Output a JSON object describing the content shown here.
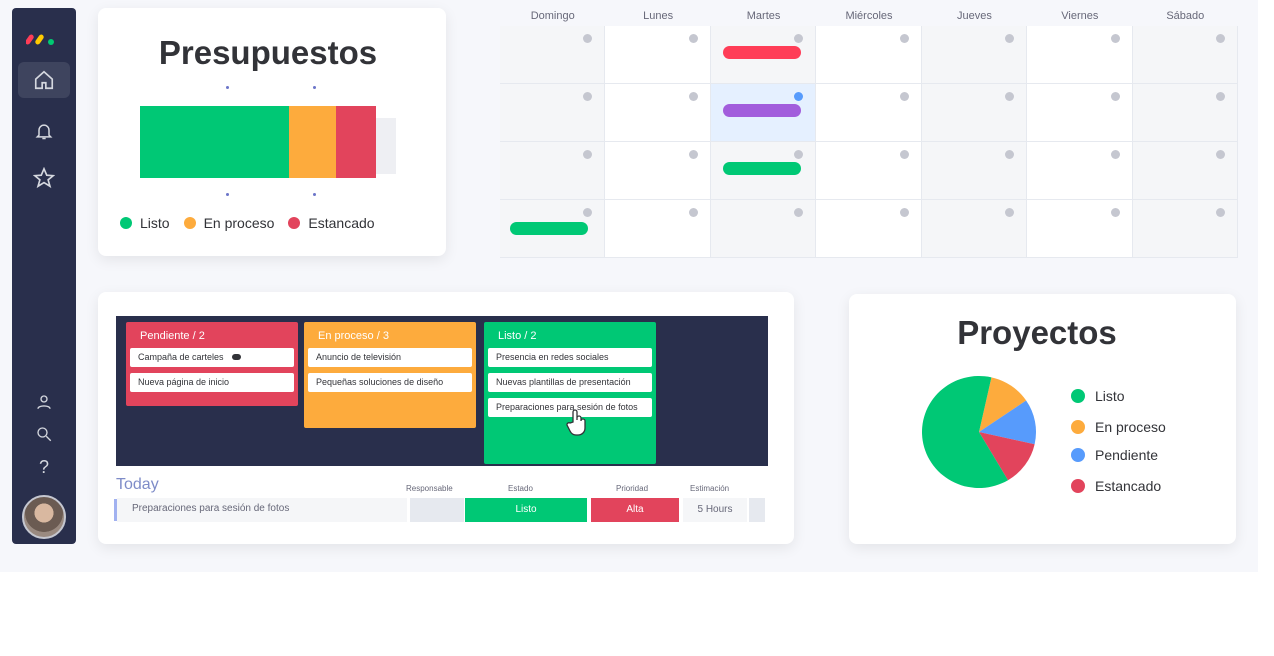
{
  "sidebar": {
    "icons": [
      "home-icon",
      "bell-icon",
      "star-icon",
      "user-icon",
      "search-icon",
      "help-icon"
    ],
    "help_glyph": "?",
    "logo_colors": [
      "#ff3d57",
      "#ffcb00",
      "#00ca72"
    ]
  },
  "budget": {
    "title": "Presupuestos",
    "segments": [
      {
        "label": "Listo",
        "value": 0.63,
        "color": "#00c875"
      },
      {
        "label": "En proceso",
        "value": 0.2,
        "color": "#fdab3d"
      },
      {
        "label": "Estancado",
        "value": 0.17,
        "color": "#e2445c"
      }
    ],
    "legend": [
      "Listo",
      "En proceso",
      "Estancado"
    ]
  },
  "calendar": {
    "days": [
      "Domingo",
      "Lunes",
      "Martes",
      "Miércoles",
      "Jueves",
      "Viernes",
      "Sábado"
    ],
    "events": [
      {
        "week": 0,
        "day": 2,
        "color": "#ff3d57"
      },
      {
        "week": 1,
        "day": 2,
        "color": "#a25ddc"
      },
      {
        "week": 2,
        "day": 2,
        "color": "#00c875"
      },
      {
        "week": 3,
        "day": 0,
        "color": "#00c875"
      }
    ]
  },
  "kanban": {
    "columns": [
      {
        "title": "Pendiente / 2",
        "color": "#e2445c",
        "cards": [
          "Campaña de carteles",
          "Nueva página de inicio"
        ]
      },
      {
        "title": "En proceso / 3",
        "color": "#fdab3d",
        "cards": [
          "Anuncio de televisión",
          "Pequeñas soluciones de diseño"
        ]
      },
      {
        "title": "Listo / 2",
        "color": "#00c875",
        "cards": [
          "Presencia en redes sociales",
          "Nuevas plantillas de presentación",
          "Preparaciones para sesión de fotos"
        ]
      }
    ],
    "today": {
      "label": "Today",
      "headers": [
        "Responsable",
        "Estado",
        "Prioridad",
        "Estimación"
      ],
      "row": {
        "name": "Preparaciones para sesión de fotos",
        "estado": "Listo",
        "prioridad": "Alta",
        "estimacion": "5 Hours"
      }
    }
  },
  "projects": {
    "title": "Proyectos",
    "slices": [
      {
        "label": "Listo",
        "value": 0.62,
        "color": "#00c875"
      },
      {
        "label": "En proceso",
        "value": 0.12,
        "color": "#fdab3d"
      },
      {
        "label": "Pendiente",
        "value": 0.13,
        "color": "#579bfc"
      },
      {
        "label": "Estancado",
        "value": 0.13,
        "color": "#e2445c"
      }
    ],
    "legend": [
      "Listo",
      "En proceso",
      "Pendiente",
      "Estancado"
    ]
  }
}
